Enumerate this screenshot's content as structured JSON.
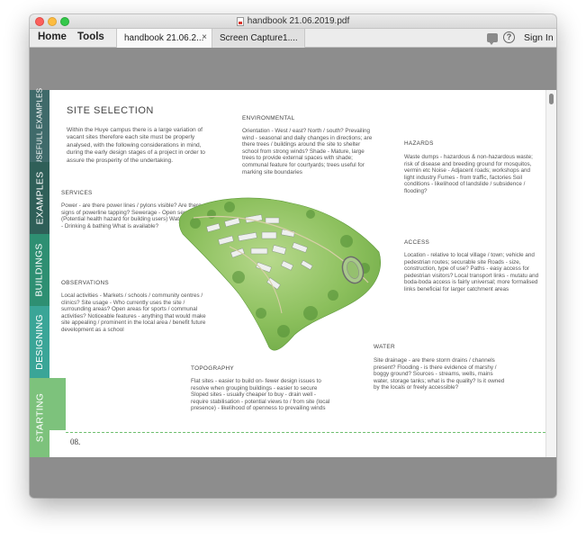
{
  "window": {
    "title": "handbook 21.06.2019.pdf",
    "colors": {
      "close": "#fc605c",
      "minimize": "#fdbc40",
      "maximize": "#34c84a"
    }
  },
  "toolbar": {
    "home_label": "Home",
    "tools_label": "Tools",
    "tabs": [
      {
        "label": "handbook 21.06.2...",
        "close": "×"
      },
      {
        "label": "Screen Capture1...."
      }
    ],
    "help_glyph": "?",
    "signin_label": "Sign In"
  },
  "page": {
    "side_tabs": [
      {
        "label": "USEFULL EXAMPLES",
        "color": "#3f6a6a"
      },
      {
        "label": "EXAMPLES",
        "color": "#2f5f58"
      },
      {
        "label": "BUILDINGS",
        "color": "#2e8f72"
      },
      {
        "label": "DESIGNING",
        "color": "#3aa597"
      },
      {
        "label": "STARTING",
        "color": "#7dc27c"
      }
    ],
    "title": "SITE SELECTION",
    "intro": "Within the Huye campus there is a large variation of vacant sites therefore each site must be properly analysed, with the following considerations in mind, during the early design stages of a project in order to assure the prosperity of the undertaking.",
    "sections": {
      "services": {
        "heading": "SERVICES",
        "body": "Power - are there power lines / pylons visible? Are there signs of powerline tapping? Sewerage - Open sewers? (Potential health hazard for building users) Water supply - Drinking & bathing What is available?"
      },
      "observations": {
        "heading": "OBSERVATIONS",
        "body": "Local activities - Markets / schools / community centres / clinics? Site usage - Who currently uses the site / surrounding areas? Open areas for sports / communal activities? Noticeable features - anything that would make site appealing / prominent in the local area / benefit future development as a school"
      },
      "environmental": {
        "heading": "ENVIRONMENTAL",
        "body": "Orientation - West / east? North / south? Prevailing wind - seasonal and daily changes in directions; are there trees / buildings around the site to shelter school from strong winds? Shade - Mature, large trees to provide external spaces with shade; communal feature for courtyards; trees useful for marking site boundaries"
      },
      "hazards": {
        "heading": "HAZARDS",
        "body": "Waste dumps - hazardous & non-hazardous waste; risk of disease and breeding ground for mosquitos, vermin etc Noise - Adjacent roads; workshops and light industry Fumes - from traffic, factories Soil conditions - likelihood of landslide / subsidence / flooding?"
      },
      "access": {
        "heading": "ACCESS",
        "body": "Location - relative to local village / town; vehicle and pedestrian routes; securable site Roads - size, construction, type of use? Paths - easy access for pedestrian visitors? Local transport links - mutatu and boda-boda access is fairly universal; more formalised links beneficial for larger catchment areas"
      },
      "water": {
        "heading": "WATER",
        "body": "Site drainage - are there storm drains / channels present? Flooding - is there evidence of marshy / boggy ground? Sources - streams, wells, mains water, storage tanks; what is the quality? Is it owned by the locals or freely accessible?"
      },
      "topography": {
        "heading": "TOPOGRAPHY",
        "body": "Flat sites - easier to build on- fewer design issues to resolve when grouping buildings - easier to secure Sloped sites - usually cheaper to buy - drain well - require stabilisation - potential views to / from site (local presence) - likelihood of openness to prevailing winds"
      }
    },
    "page_number": "08."
  }
}
